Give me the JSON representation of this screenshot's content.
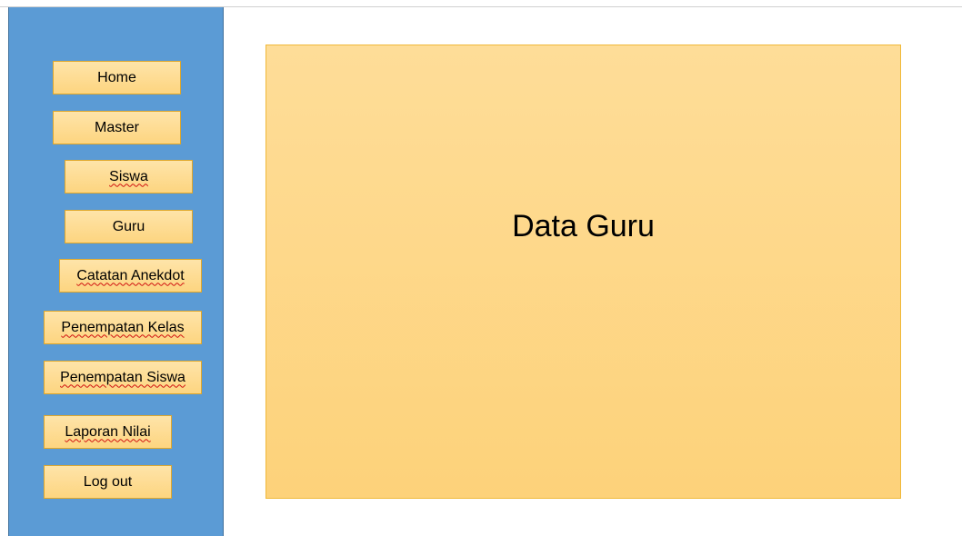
{
  "sidebar": {
    "items": [
      {
        "label": "Home"
      },
      {
        "label": "Master"
      },
      {
        "label": "Siswa"
      },
      {
        "label": "Guru"
      },
      {
        "label": "Catatan Anekdot"
      },
      {
        "label": "Penempatan Kelas"
      },
      {
        "label": "Penempatan Siswa"
      },
      {
        "label": "Laporan Nilai"
      },
      {
        "label": "Log out"
      }
    ]
  },
  "main": {
    "title": "Data Guru"
  },
  "colors": {
    "sidebar_bg": "#5b9bd5",
    "button_fill": "#fdd580",
    "panel_fill": "#fdd27a"
  }
}
